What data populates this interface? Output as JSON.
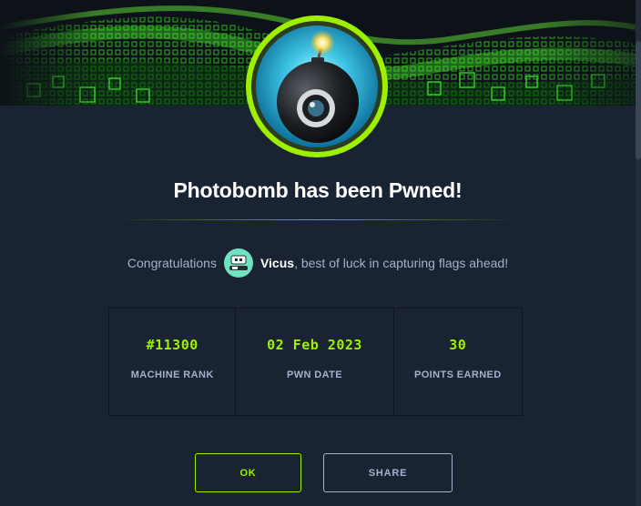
{
  "modal": {
    "title": "Photobomb has been Pwned!",
    "congrats_prefix": "Congratulations",
    "username": "Vicus",
    "congrats_suffix": ", best of luck in capturing flags ahead!"
  },
  "stats": [
    {
      "value": "#11300",
      "label": "MACHINE RANK"
    },
    {
      "value": "02 Feb 2023",
      "label": "PWN DATE"
    },
    {
      "value": "30",
      "label": "POINTS EARNED"
    }
  ],
  "buttons": {
    "ok_label": "OK",
    "share_label": "SHARE"
  },
  "colors": {
    "accent": "#9fef00",
    "background": "#1a2332",
    "muted_text": "#a4b1cd"
  },
  "icons": {
    "machine_avatar": "bomb-camera-icon",
    "user_avatar": "user-avatar-icon"
  }
}
